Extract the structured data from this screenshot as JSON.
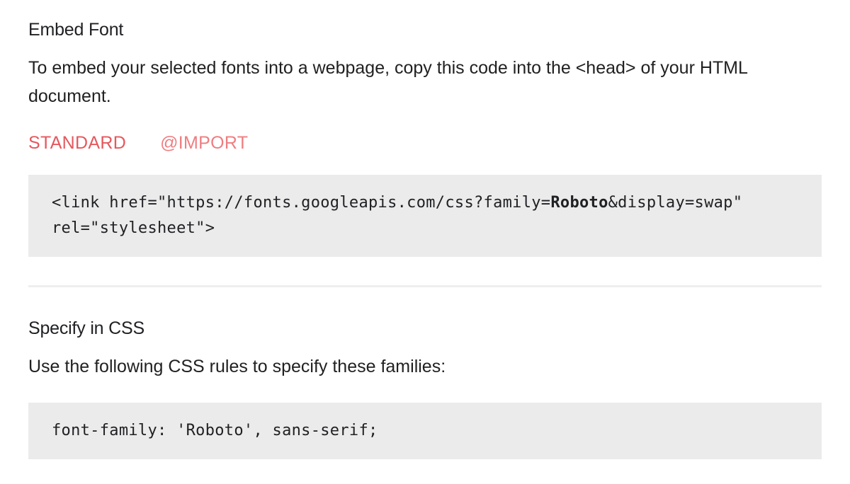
{
  "embed": {
    "title": "Embed Font",
    "description": "To embed your selected fonts into a webpage, copy this code into the <head> of your HTML document.",
    "tabs": [
      {
        "label": "STANDARD",
        "active": true
      },
      {
        "label": "@IMPORT",
        "active": false
      }
    ],
    "code": {
      "line1_prefix": "<link href=\"https://fonts.googleapis.com/css?family=",
      "line1_family": "Roboto",
      "line1_suffix": "&display=swap\"",
      "line2": "rel=\"stylesheet\">"
    }
  },
  "css": {
    "title": "Specify in CSS",
    "description": "Use the following CSS rules to specify these families:",
    "code": "font-family: 'Roboto', sans-serif;"
  },
  "colors": {
    "accent_active": "#e5585e",
    "accent_inactive": "#ef7d80",
    "code_background": "#ebebeb"
  }
}
